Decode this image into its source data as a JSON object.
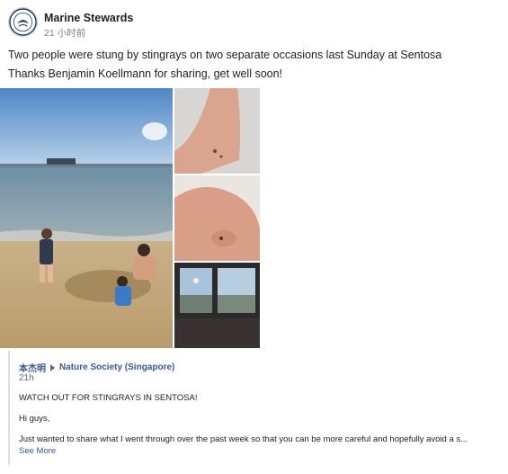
{
  "post": {
    "page_name": "Marine Stewards",
    "timestamp": "21 小时前",
    "line1": "Two people were stung by stingrays on two separate occasions last Sunday at Sentosa",
    "line2": "Thanks Benjamin Koellmann for sharing, get well soon!"
  },
  "photos": [
    {
      "subject": "beach-with-children"
    },
    {
      "subject": "foot-top-sting"
    },
    {
      "subject": "foot-sole-sting"
    },
    {
      "subject": "window-view"
    }
  ],
  "shared": {
    "author": "本杰明",
    "target_page": "Nature Society (Singapore)",
    "time": "21h",
    "text1": "WATCH OUT FOR STINGRAYS IN SENTOSA!",
    "text2": "Hi guys,",
    "text3": "Just wanted to share what I went through over the past week so that you can be more careful and hopefully avoid a s...",
    "see_more": "See More"
  },
  "colors": {
    "link": "#385898",
    "meta": "#7f7f7f",
    "text": "#1c1e21"
  }
}
